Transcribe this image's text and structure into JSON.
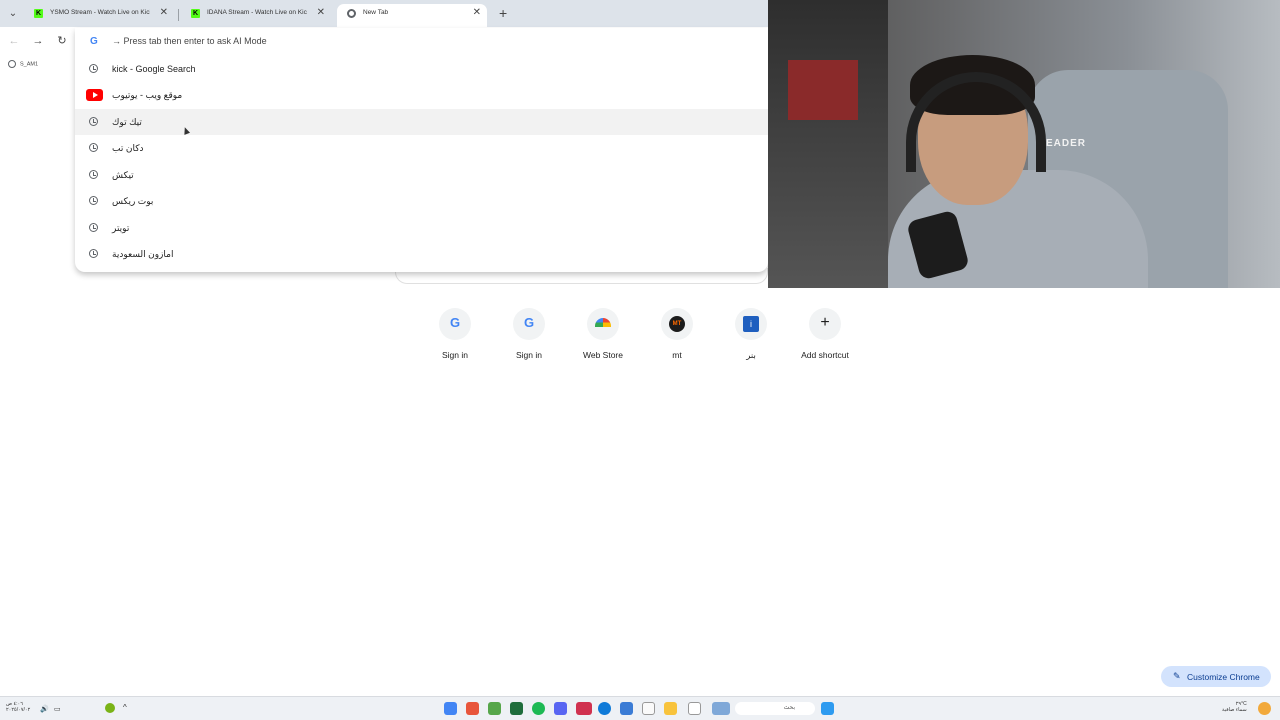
{
  "browser": {
    "tabs": [
      {
        "title": "YSMO Stream - Watch Live on Kick",
        "favicon": "kick-icon",
        "active": false
      },
      {
        "title": "IDANA Stream - Watch Live on Kick",
        "favicon": "kick-icon",
        "active": false
      },
      {
        "title": "New Tab",
        "favicon": "chrome-icon",
        "active": true
      }
    ],
    "bookmark": "S_AM1"
  },
  "omnibox": {
    "hint": "→ Press tab then enter to ask AI Mode",
    "suggestions": [
      {
        "label": "kick - Google Search",
        "icon": "history-icon"
      },
      {
        "label": "موقع ويب - يوتيوب",
        "icon": "youtube-icon"
      },
      {
        "label": "تيك توك",
        "icon": "history-icon"
      },
      {
        "label": "دكان تب",
        "icon": "history-icon"
      },
      {
        "label": "تيكش",
        "icon": "history-icon"
      },
      {
        "label": "بوت ريكس",
        "icon": "history-icon"
      },
      {
        "label": "تويتر",
        "icon": "history-icon"
      },
      {
        "label": "امازون السعودية",
        "icon": "history-icon"
      }
    ]
  },
  "shortcuts": [
    {
      "name": "Sign in",
      "icon": "google-icon",
      "glyph": "G"
    },
    {
      "name": "Sign in",
      "icon": "google-icon",
      "glyph": "G"
    },
    {
      "name": "Web Store",
      "icon": "chrome-web-store-icon"
    },
    {
      "name": "mt",
      "icon": "mt-icon",
      "glyph": "MT"
    },
    {
      "name": "بنر",
      "icon": "bnr-icon",
      "glyph": "i"
    },
    {
      "name": "Add shortcut",
      "icon": "plus-icon",
      "glyph": "+"
    }
  ],
  "customize": {
    "label": "Customize Chrome"
  },
  "webcam": {
    "chair_brand": "EADER"
  },
  "taskbar": {
    "search_placeholder": "بحث",
    "clock_time": "٤:٠٦ ص",
    "clock_date": "٢٠٢٥/٠٧/٠٢",
    "weather": "٢٩°C",
    "weather_text": "سماء صافية"
  },
  "colors": {
    "tabstrip": "#dde3ea",
    "accent": "#d3e3fd",
    "youtube": "#ff0000",
    "kick": "#53fc18"
  }
}
